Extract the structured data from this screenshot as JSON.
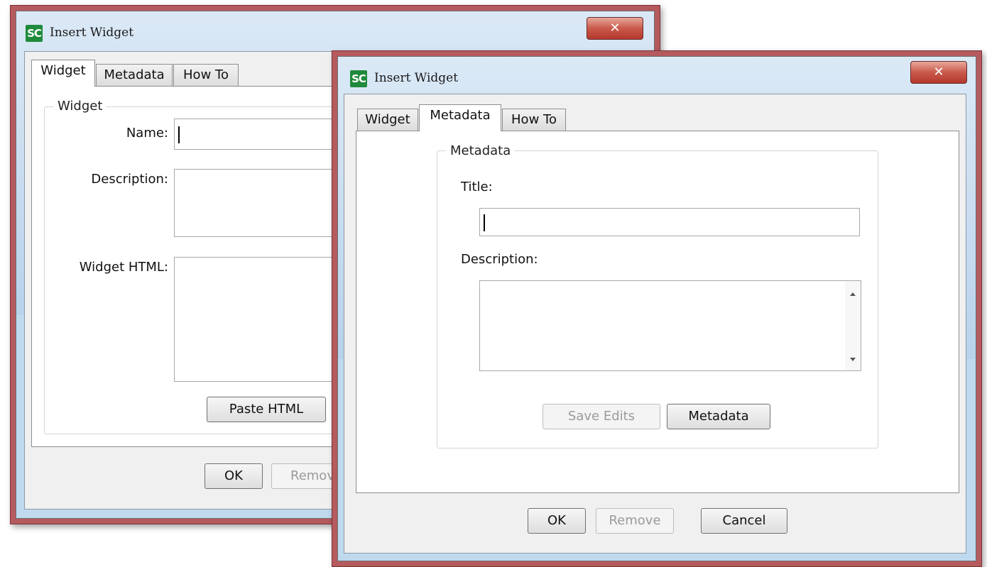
{
  "back_window": {
    "title": "Insert Widget",
    "logo": "SC",
    "close_glyph": "✕",
    "tabs": [
      {
        "label": "Widget",
        "active": true
      },
      {
        "label": "Metadata",
        "active": false
      },
      {
        "label": "How To",
        "active": false
      }
    ],
    "group_label": "Widget",
    "name_label": "Name:",
    "description_label": "Description:",
    "widget_html_label": "Widget HTML:",
    "paste_html_label": "Paste HTML",
    "ok_label": "OK",
    "remove_label_partial": "Remov"
  },
  "front_window": {
    "title": "Insert Widget",
    "logo": "SC",
    "close_glyph": "✕",
    "tabs": [
      {
        "label": "Widget",
        "active": false
      },
      {
        "label": "Metadata",
        "active": true
      },
      {
        "label": "How To",
        "active": false
      }
    ],
    "group_label": "Metadata",
    "title_label": "Title:",
    "description_label": "Description:",
    "save_edits_label": "Save Edits",
    "metadata_button_label": "Metadata",
    "ok_label": "OK",
    "remove_label": "Remove",
    "cancel_label": "Cancel"
  },
  "colors": {
    "window_frame": "#b55a5e",
    "title_bar": "#bfd9ee",
    "close_button": "#c9594a",
    "logo_green": "#1f8a3b"
  }
}
